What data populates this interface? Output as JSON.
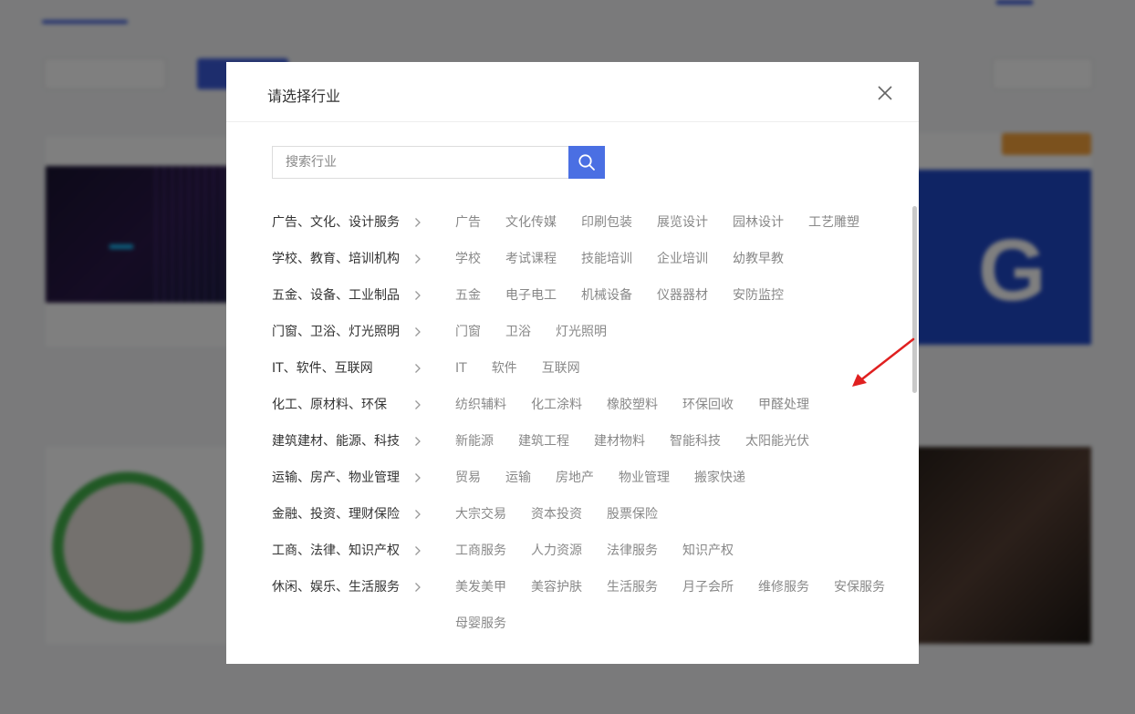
{
  "modal": {
    "title": "请选择行业",
    "search": {
      "placeholder": "搜索行业",
      "value": ""
    },
    "categories": [
      {
        "label": "广告、文化、设计服务",
        "subs": [
          "广告",
          "文化传媒",
          "印刷包装",
          "展览设计",
          "园林设计",
          "工艺雕塑"
        ]
      },
      {
        "label": "学校、教育、培训机构",
        "subs": [
          "学校",
          "考试课程",
          "技能培训",
          "企业培训",
          "幼教早教"
        ]
      },
      {
        "label": "五金、设备、工业制品",
        "subs": [
          "五金",
          "电子电工",
          "机械设备",
          "仪器器材",
          "安防监控"
        ]
      },
      {
        "label": "门窗、卫浴、灯光照明",
        "subs": [
          "门窗",
          "卫浴",
          "灯光照明"
        ]
      },
      {
        "label": "IT、软件、互联网",
        "subs": [
          "IT",
          "软件",
          "互联网"
        ]
      },
      {
        "label": "化工、原材料、环保",
        "subs": [
          "纺织辅料",
          "化工涂料",
          "橡胶塑料",
          "环保回收",
          "甲醛处理"
        ]
      },
      {
        "label": "建筑建材、能源、科技",
        "subs": [
          "新能源",
          "建筑工程",
          "建材物料",
          "智能科技",
          "太阳能光伏"
        ]
      },
      {
        "label": "运输、房产、物业管理",
        "subs": [
          "贸易",
          "运输",
          "房地产",
          "物业管理",
          "搬家快递"
        ]
      },
      {
        "label": "金融、投资、理财保险",
        "subs": [
          "大宗交易",
          "资本投资",
          "股票保险"
        ]
      },
      {
        "label": "工商、法律、知识产权",
        "subs": [
          "工商服务",
          "人力资源",
          "法律服务",
          "知识产权"
        ]
      },
      {
        "label": "休闲、娱乐、生活服务",
        "subs": [
          "美发美甲",
          "美容护肤",
          "生活服务",
          "月子会所",
          "维修服务",
          "安保服务",
          "母婴服务"
        ]
      }
    ]
  },
  "colors": {
    "accent": "#4a6fe3",
    "annotation": "#e02020",
    "overlay": "rgba(0,0,0,0.5)"
  },
  "icons": {
    "close": "close-icon",
    "search": "search-icon",
    "chevron": "chevron-right-icon",
    "annotation": "red-arrow-icon"
  }
}
